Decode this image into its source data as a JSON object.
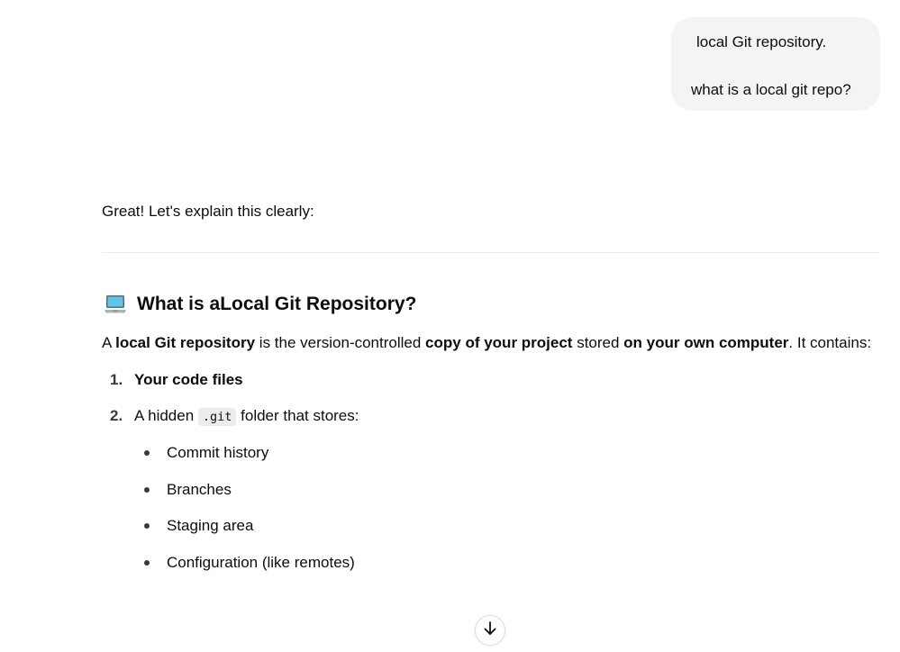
{
  "user_message": {
    "line1": "local Git repository.",
    "line2": "what is a local git repo?"
  },
  "assistant": {
    "intro": "Great! Let's explain this clearly:",
    "heading": {
      "icon": "laptop-icon",
      "prefix": "What is a ",
      "bold": "Local Git Repository",
      "suffix": "?"
    },
    "paragraph": {
      "t1": "A ",
      "b1": "local Git repository",
      "t2": " is the version-controlled ",
      "b2": "copy of your project",
      "t3": " stored ",
      "b3": "on your own computer",
      "t4": ". It contains:"
    },
    "list": [
      {
        "num": "1.",
        "bold": "Your code files"
      },
      {
        "num": "2.",
        "prefix": "A hidden ",
        "code": ".git",
        "suffix": " folder that stores:"
      }
    ],
    "sub_items": [
      "Commit history",
      "Branches",
      "Staging area",
      "Configuration (like remotes)"
    ]
  },
  "scroll_button": {
    "icon": "arrow-down-icon"
  },
  "colors": {
    "bubble_bg": "#f4f4f4",
    "text": "#0d0d0d",
    "code_bg": "#ececec",
    "divider": "#ececec"
  }
}
